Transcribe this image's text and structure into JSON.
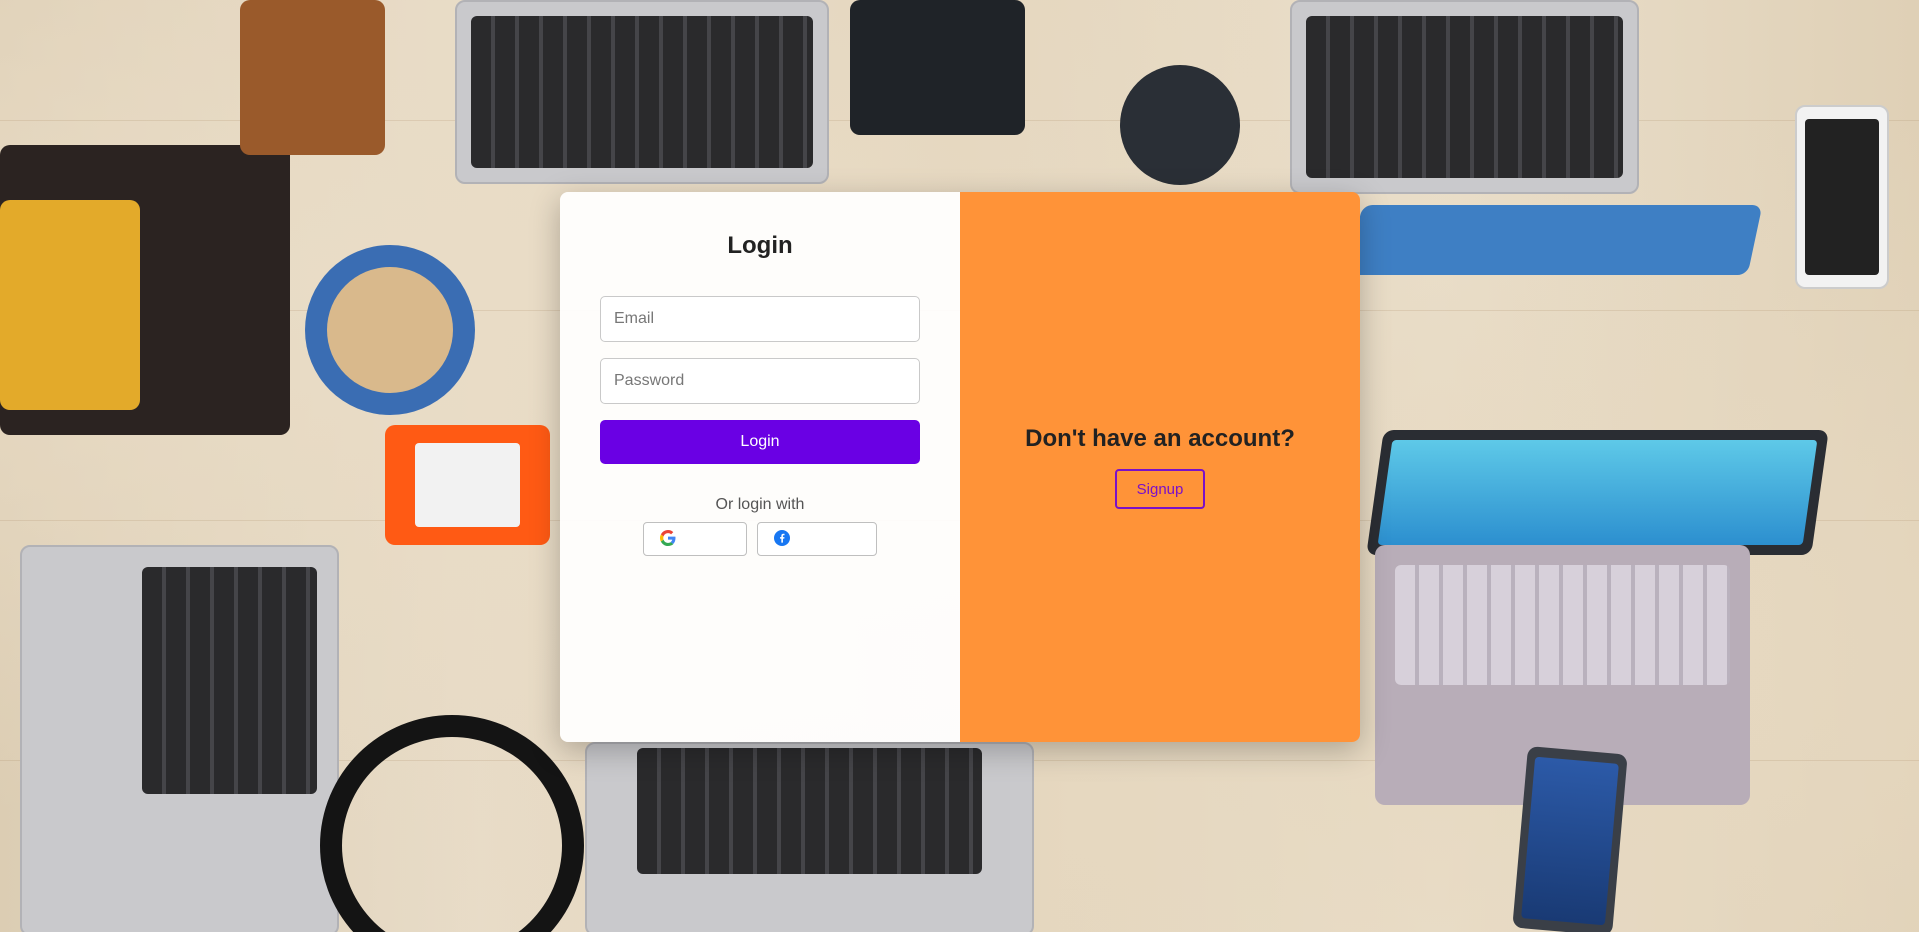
{
  "login": {
    "title": "Login",
    "email_placeholder": "Email",
    "password_placeholder": "Password",
    "submit_label": "Login",
    "or_text": "Or login with",
    "social": [
      {
        "icon": "google-icon"
      },
      {
        "icon": "facebook-icon"
      }
    ]
  },
  "signup": {
    "title": "Don't have an account?",
    "button_label": "Signup"
  },
  "colors": {
    "primary": "#6a00e4",
    "accent_panel": "#ff9338",
    "signup_border": "#7a10c8"
  }
}
